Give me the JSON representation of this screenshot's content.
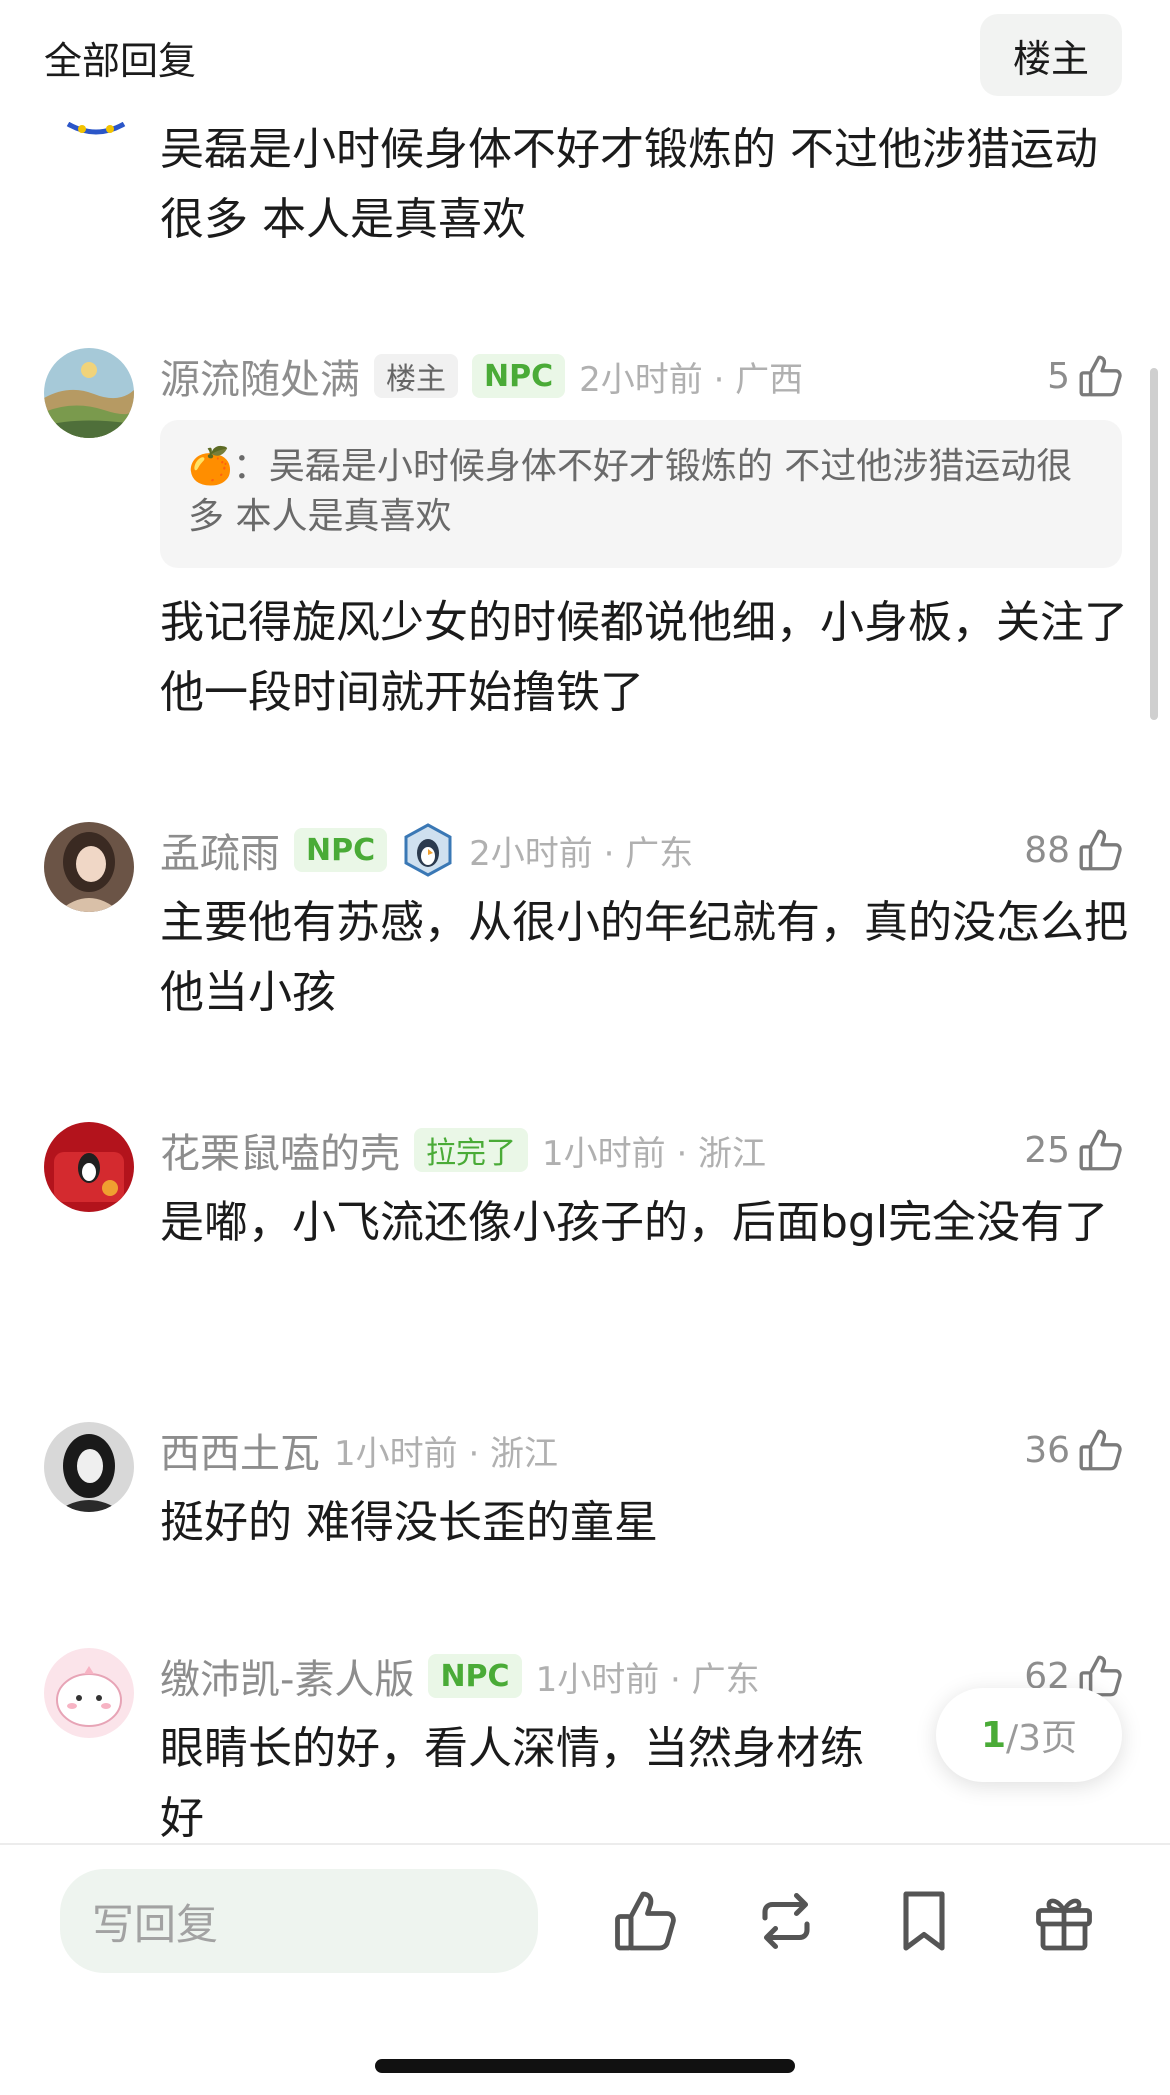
{
  "header": {
    "title": "全部回复",
    "owner_button": "楼主"
  },
  "top_comment": {
    "text": "吴磊是小时候身体不好才锻炼的  不过他涉猎运动很多  本人是真喜欢"
  },
  "comments": [
    {
      "username": "源流随处满",
      "badges": [
        "楼主",
        "NPC"
      ],
      "meta": "2小时前 · 广西",
      "likes": "5",
      "quote": {
        "emoji": "🍊",
        "text": "：吴磊是小时候身体不好才锻炼的  不过他涉猎运动很多  本人是真喜欢"
      },
      "text": "我记得旋风少女的时候都说他细，小身板，关注了他一段时间就开始撸铁了"
    },
    {
      "username": "孟疏雨",
      "badges": [
        "NPC"
      ],
      "badge_icon": "penguin-badge-icon",
      "meta": "2小时前 · 广东",
      "likes": "88",
      "text": "主要他有苏感，从很小的年纪就有，真的没怎么把他当小孩"
    },
    {
      "username": "花栗鼠嗑的壳",
      "badges": [
        "拉完了"
      ],
      "meta": "1小时前 · 浙江",
      "likes": "25",
      "text": "是嘟，小飞流还像小孩子的，后面bgl完全没有了"
    },
    {
      "username": "西西土瓦",
      "badges": [],
      "meta": "1小时前 · 浙江",
      "likes": "36",
      "text": "挺好的 难得没长歪的童星"
    },
    {
      "username": "缴沛凯-素人版",
      "badges": [
        "NPC"
      ],
      "meta": "1小时前 · 广东",
      "likes": "62",
      "text": "眼睛长的好，看人深情，当然身材练"
    }
  ],
  "last_line": "好",
  "pager": {
    "current": "1",
    "rest": "/3页"
  },
  "bottom_bar": {
    "reply_placeholder": "写回复",
    "icons": [
      "thumbs-up-icon",
      "repost-icon",
      "bookmark-icon",
      "gift-icon"
    ]
  },
  "colors": {
    "accent_green": "#4aab37",
    "badge_green_bg": "#eaf7e7",
    "meta_gray": "#b0b0b0"
  }
}
